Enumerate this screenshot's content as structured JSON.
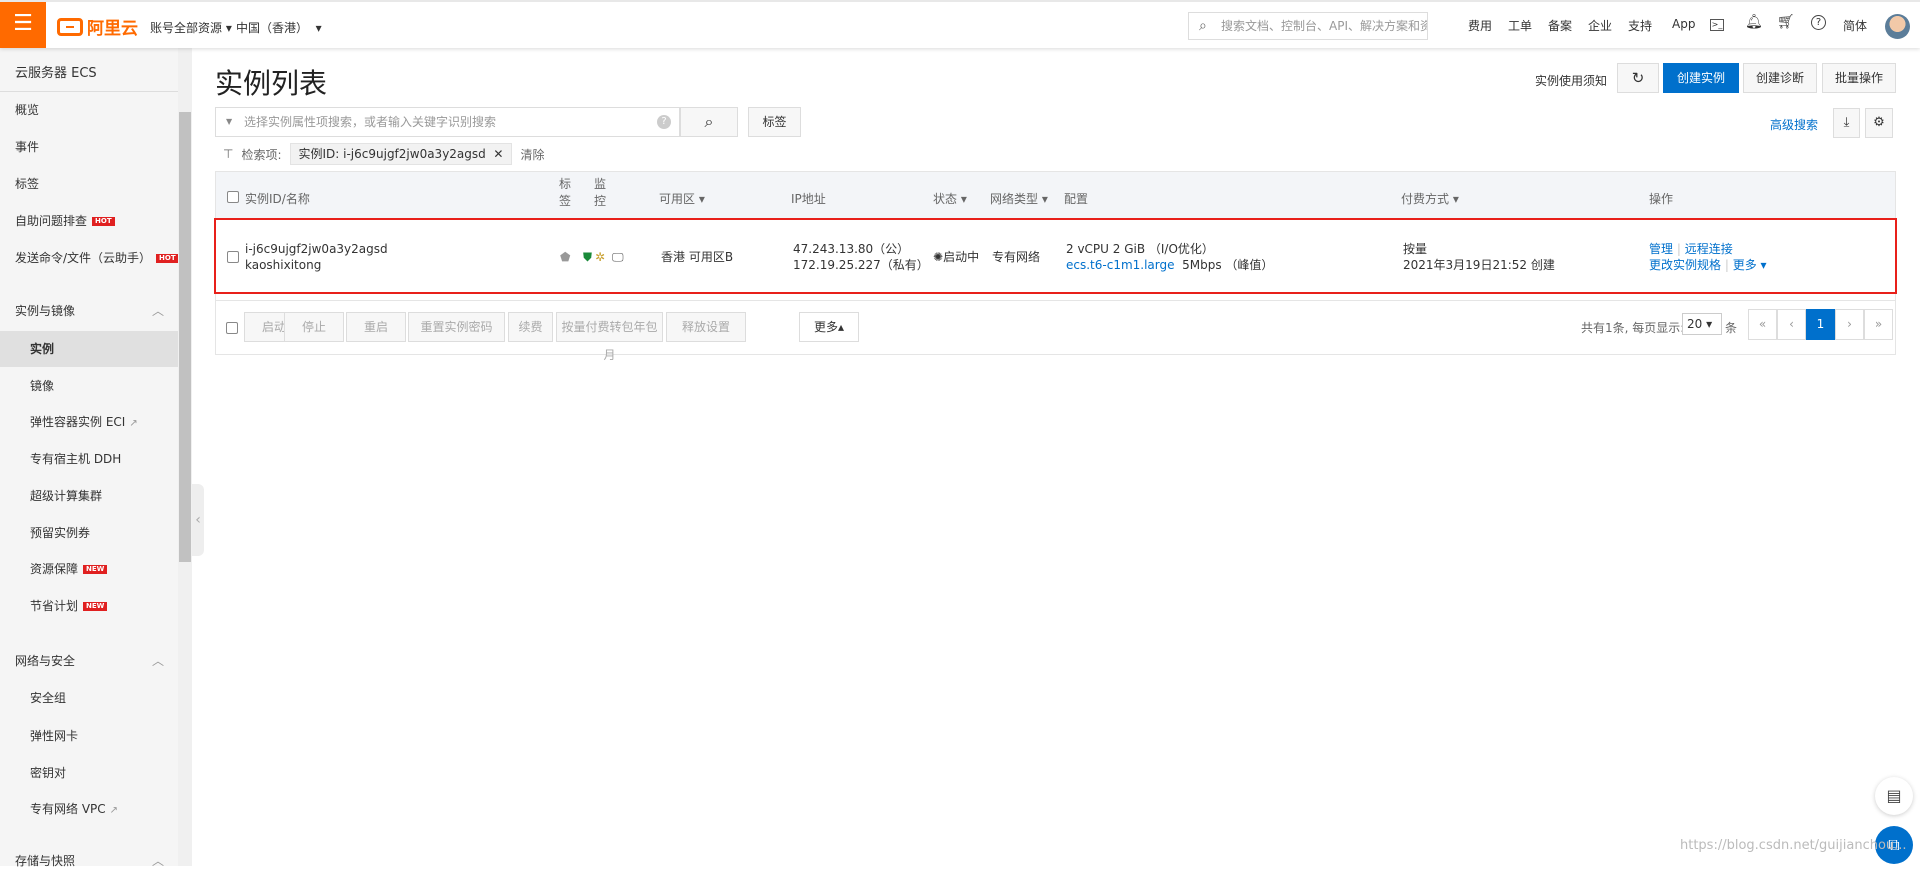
{
  "topbar": {
    "logo": "阿里云",
    "account": "账号全部资源",
    "region": "中国（香港）",
    "search_placeholder": "搜索文档、控制台、API、解决方案和资源",
    "nav": [
      "费用",
      "工单",
      "备案",
      "企业",
      "支持",
      "App"
    ],
    "lang": "简体"
  },
  "sidebar": {
    "title": "云服务器 ECS",
    "items": [
      {
        "label": "概览"
      },
      {
        "label": "事件"
      },
      {
        "label": "标签"
      },
      {
        "label": "自助问题排查",
        "badge": "HOT"
      },
      {
        "label": "发送命令/文件（云助手）",
        "badge": "HOT"
      },
      {
        "label": "实例与镜像",
        "section": true
      },
      {
        "label": "实例",
        "active": true
      },
      {
        "label": "镜像"
      },
      {
        "label": "弹性容器实例 ECI",
        "external": true
      },
      {
        "label": "专有宿主机 DDH"
      },
      {
        "label": "超级计算集群"
      },
      {
        "label": "预留实例券"
      },
      {
        "label": "资源保障",
        "badge": "NEW"
      },
      {
        "label": "节省计划",
        "badge": "NEW"
      },
      {
        "label": "网络与安全",
        "section": true
      },
      {
        "label": "安全组"
      },
      {
        "label": "弹性网卡"
      },
      {
        "label": "密钥对"
      },
      {
        "label": "专有网络 VPC",
        "external": true
      },
      {
        "label": "存储与快照",
        "section": true
      }
    ]
  },
  "page": {
    "title": "实例列表",
    "notice": "实例使用须知",
    "create": "创建实例",
    "diagnose": "创建诊断",
    "batch": "批量操作",
    "advanced_search": "高级搜索",
    "search_placeholder": "选择实例属性项搜索，或者输入关键字识别搜索",
    "tag_button": "标签",
    "filter_label": "检索项:",
    "filter_chip": "实例ID: i-j6c9ujgf2jw0a3y2agsd",
    "clear": "清除"
  },
  "table": {
    "headers": {
      "id": "实例ID/名称",
      "tag": "标签",
      "monitor": "监控",
      "zone": "可用区",
      "ip": "IP地址",
      "status": "状态",
      "network": "网络类型",
      "config": "配置",
      "billing": "付费方式",
      "actions": "操作"
    },
    "rows": [
      {
        "id": "i-j6c9ujgf2jw0a3y2agsd",
        "name": "kaoshixitong",
        "zone": "香港 可用区B",
        "ip_public": "47.243.13.80（公）",
        "ip_private": "172.19.25.227（私有）",
        "status": "启动中",
        "network": "专有网络",
        "config": "2 vCPU 2 GiB （I/O优化）",
        "type": "ecs.t6-c1m1.large",
        "bandwidth": "5Mbps （峰值）",
        "billing": "按量",
        "created": "2021年3月19日21:52 创建",
        "actions": [
          "管理",
          "远程连接",
          "更改实例规格",
          "更多"
        ]
      }
    ]
  },
  "bulk": {
    "buttons": [
      "启动",
      "停止",
      "重启",
      "重置实例密码",
      "续费",
      "按量付费转包年包月",
      "释放设置"
    ],
    "more": "更多▴"
  },
  "pagination": {
    "total": "共有1条, 每页显示:",
    "page_size": "20",
    "unit": "条",
    "current": "1"
  },
  "watermark": "https://blog.csdn.net/guijianchou..."
}
